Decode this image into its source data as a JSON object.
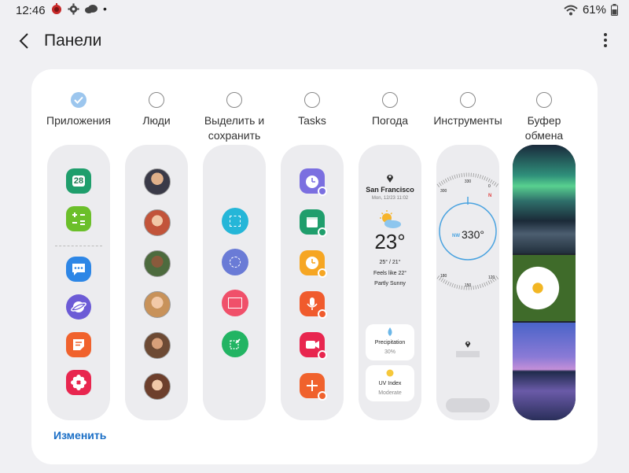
{
  "status": {
    "time": "12:46",
    "battery": "61%"
  },
  "header": {
    "title": "Панели"
  },
  "panels": [
    {
      "label": "Приложения",
      "selected": true
    },
    {
      "label": "Люди",
      "selected": false
    },
    {
      "label": "Выделить и\nсохранить",
      "selected": false
    },
    {
      "label": "Tasks",
      "selected": false
    },
    {
      "label": "Погода",
      "selected": false
    },
    {
      "label": "Инструменты",
      "selected": false
    },
    {
      "label": "Буфер\nобмена",
      "selected": false
    }
  ],
  "apps": {
    "calendar_date": "28"
  },
  "weather": {
    "city": "San Francisco",
    "date": "Mon, 12/23 11:02",
    "temp": "23°",
    "range": "25° / 21°",
    "feels": "Feels like 22°",
    "condition": "Partly Sunny",
    "precip_label": "Precipitation",
    "precip_value": "30%",
    "uv_label": "UV Index",
    "uv_value": "Moderate"
  },
  "compass": {
    "reading": "330°",
    "direction": "NW",
    "top": "330",
    "bottom": "150",
    "tl": "300",
    "tr": "0",
    "bl": "180",
    "br": "120",
    "n": "N"
  },
  "footer": {
    "edit": "Изменить"
  },
  "colors": {
    "accent": "#1b6fc6",
    "check": "#9cc6ee"
  }
}
